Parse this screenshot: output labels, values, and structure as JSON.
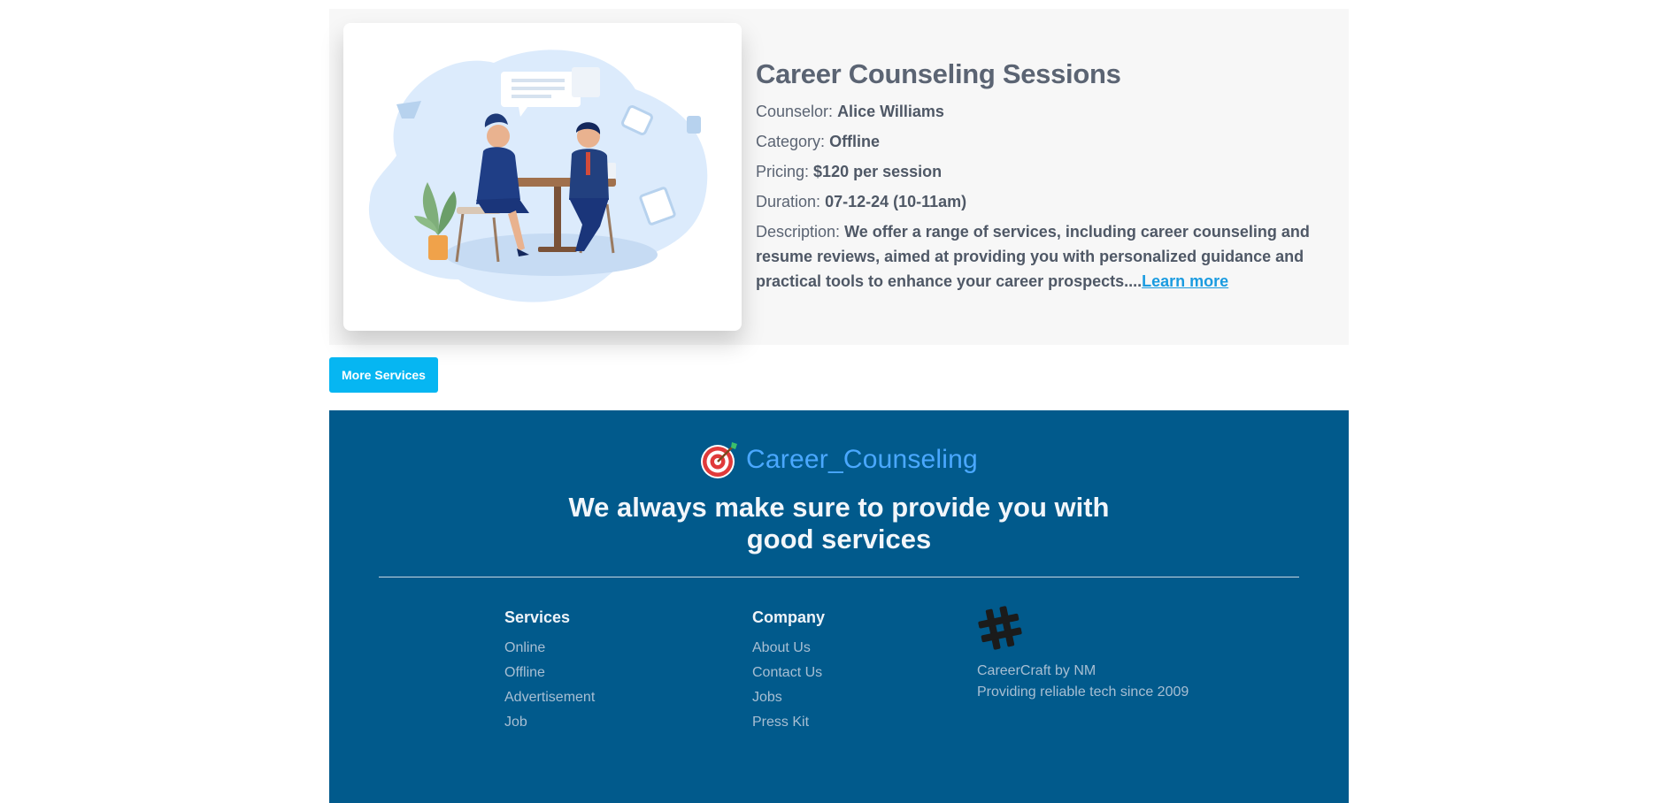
{
  "service": {
    "title": "Career Counseling Sessions",
    "counselor_label": "Counselor:",
    "counselor": "Alice Williams",
    "category_label": "Category:",
    "category": "Offline",
    "pricing_label": "Pricing:",
    "pricing": "$120 per session",
    "duration_label": "Duration:",
    "duration": "07-12-24 (10-11am)",
    "description_label": "Description:",
    "description": "We offer a range of services, including career counseling and resume reviews, aimed at providing you with personalized guidance and practical tools to enhance your career prospects....",
    "learn_more": "Learn more",
    "image_icon": "counseling-illustration"
  },
  "more_services_label": "More Services",
  "footer": {
    "brand_icon": "target-icon",
    "brand_name": "Career_Counseling",
    "tagline_line1": "We always make sure to provide you with",
    "tagline_line2": "good services",
    "services_heading": "Services",
    "services": [
      "Online",
      "Offline",
      "Advertisement",
      "Job"
    ],
    "company_heading": "Company",
    "company": [
      "About Us",
      "Contact Us",
      "Jobs",
      "Press Kit"
    ],
    "about_icon": "hashtag-icon",
    "about_line1": "CareerCraft by NM",
    "about_line2": "Providing reliable tech since 2009"
  },
  "colors": {
    "footer_bg": "#015a8c",
    "button_bg": "#06b6f2",
    "brand_text": "#4aa8ff",
    "link": "#1a9be0"
  }
}
